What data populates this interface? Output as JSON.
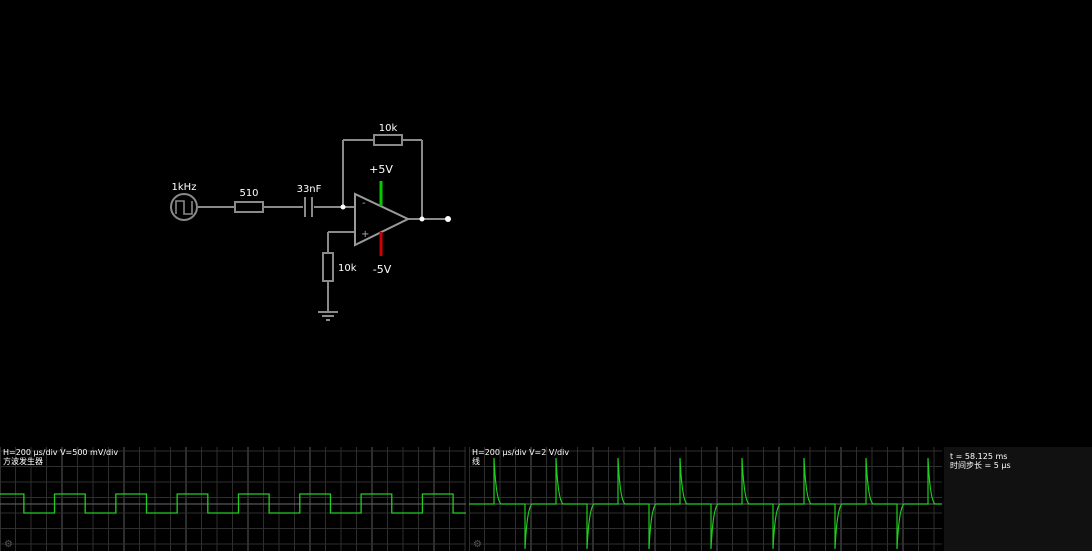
{
  "circuit": {
    "source_freq": "1kHz",
    "r_input": "510",
    "c_input": "33nF",
    "r_feedback": "10k",
    "r_ground": "10k",
    "supply_pos": "+5V",
    "supply_neg": "-5V",
    "opamp_minus": "-",
    "opamp_plus": "+",
    "colors": {
      "wire": "#8a8a8a",
      "pos_rail": "#00cc00",
      "neg_rail": "#cc0000",
      "node": "#ffffff"
    }
  },
  "scope1": {
    "settings": "H=200 µs/div V=500 mV/div",
    "label": "方波发生器",
    "trace_color": "#22cc22",
    "periods_visible": 7.6,
    "signal": "square"
  },
  "scope2": {
    "settings": "H=200 µs/div V=2 V/div",
    "label": "线",
    "trace_color": "#22cc22",
    "periods_visible": 7.6,
    "signal": "spikes"
  },
  "status": {
    "time": "t = 58.125 ms",
    "timestep": "时间步长 = 5 µs"
  }
}
